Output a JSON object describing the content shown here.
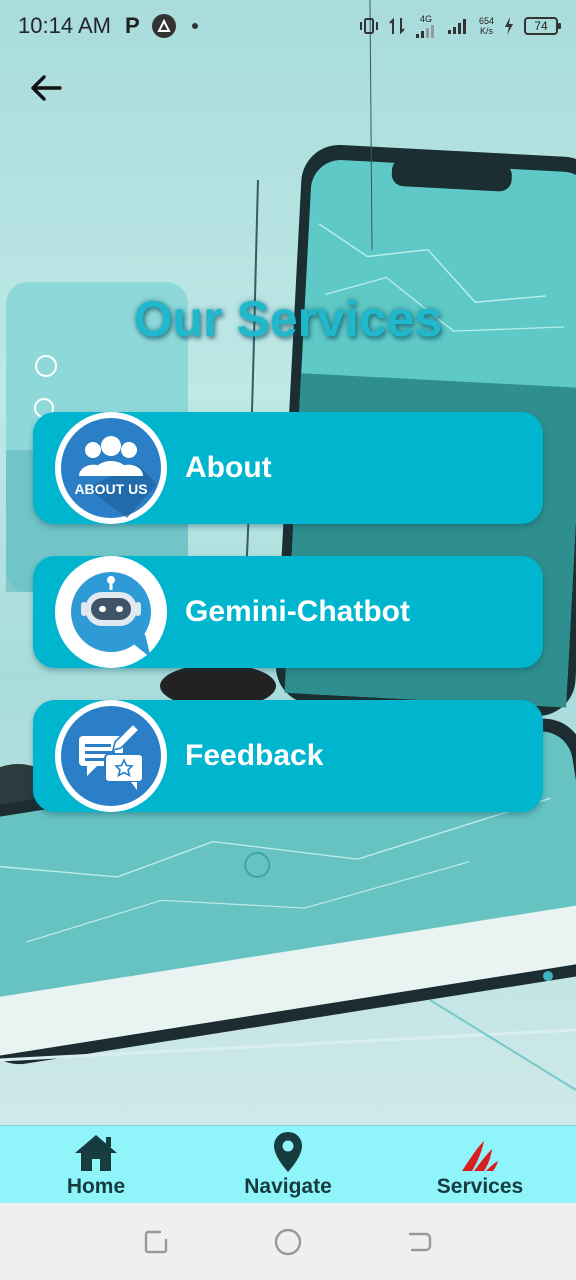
{
  "status_bar": {
    "time": "10:14 AM",
    "p_glyph": "P",
    "net_speed_value": "654",
    "net_speed_unit": "K/s",
    "network_type": "4G",
    "battery": "74"
  },
  "page": {
    "title": "Our Services",
    "back_icon": "arrow-left-icon"
  },
  "services": [
    {
      "label": "About",
      "icon": "about-us-icon",
      "icon_text": "ABOUT US"
    },
    {
      "label": "Gemini-Chatbot",
      "icon": "robot-chat-icon"
    },
    {
      "label": "Feedback",
      "icon": "feedback-icon"
    }
  ],
  "bottom_nav": {
    "items": [
      {
        "label": "Home",
        "icon": "home-icon"
      },
      {
        "label": "Navigate",
        "icon": "location-pin-icon"
      },
      {
        "label": "Services",
        "icon": "services-icon"
      }
    ],
    "active": "Services"
  },
  "colors": {
    "card": "#00b6cf",
    "title": "#1fb8cc",
    "nav_bg": "#8ff5fa",
    "services_icon": "#d81e1e"
  }
}
